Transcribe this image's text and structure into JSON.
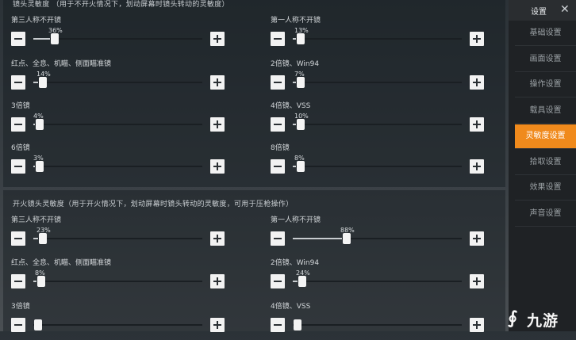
{
  "section1": {
    "title": "镜头灵敏度 （用于不开火情况下，划动屏幕时镜头转动的灵敏度）",
    "items": [
      {
        "label": "第三人称不开镜",
        "value": "36%",
        "fraction": 0.1
      },
      {
        "label": "第一人称不开镜",
        "value": "13%",
        "fraction": 0.02
      },
      {
        "label": "红点、全息、机瞄、侧面瞄准镜",
        "value": "14%",
        "fraction": 0.03
      },
      {
        "label": "2倍镜、Win94",
        "value": "7%",
        "fraction": 0.02
      },
      {
        "label": "3倍镜",
        "value": "4%",
        "fraction": 0.01
      },
      {
        "label": "4倍镜、VSS",
        "value": "10%",
        "fraction": 0.02
      },
      {
        "label": "6倍镜",
        "value": "3%",
        "fraction": 0.01
      },
      {
        "label": "8倍镜",
        "value": "8%",
        "fraction": 0.02
      }
    ]
  },
  "section2": {
    "title": "开火镜头灵敏度（用于开火情况下，划动屏幕时镜头转动的灵敏度，可用于压枪操作）",
    "items": [
      {
        "label": "第三人称不开镜",
        "value": "23%",
        "fraction": 0.03
      },
      {
        "label": "第一人称不开镜",
        "value": "88%",
        "fraction": 0.29
      },
      {
        "label": "红点、全息、机瞄、侧面瞄准镜",
        "value": "8%",
        "fraction": 0.02
      },
      {
        "label": "2倍镜、Win94",
        "value": "24%",
        "fraction": 0.03
      },
      {
        "label": "3倍镜",
        "value": "",
        "fraction": 0
      },
      {
        "label": "4倍镜、VSS",
        "value": "",
        "fraction": 0
      }
    ]
  },
  "sidebar": {
    "title": "设置",
    "close_icon": "close-icon",
    "items": [
      {
        "label": "基础设置",
        "active": false
      },
      {
        "label": "画面设置",
        "active": false
      },
      {
        "label": "操作设置",
        "active": false
      },
      {
        "label": "载具设置",
        "active": false
      },
      {
        "label": "灵敏度设置",
        "active": true
      },
      {
        "label": "拾取设置",
        "active": false
      },
      {
        "label": "效果设置",
        "active": false
      },
      {
        "label": "声音设置",
        "active": false
      }
    ]
  },
  "watermark": {
    "text": "九游"
  },
  "colors": {
    "accent": "#f08a1c",
    "sidebar_bg": "#1f2225",
    "button_bg": "#f2f2f2"
  }
}
